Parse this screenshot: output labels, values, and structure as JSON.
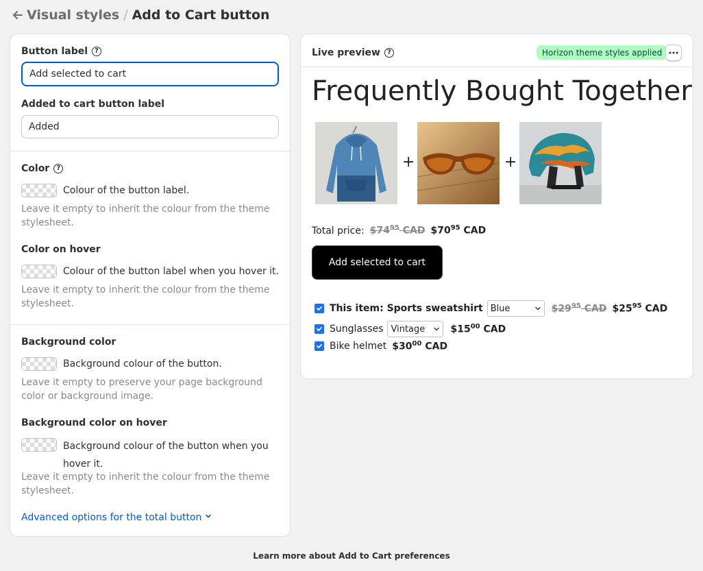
{
  "header": {
    "parent": "Visual styles",
    "separator": "/",
    "current": "Add to Cart button"
  },
  "settings": {
    "button_label": {
      "label": "Button label",
      "value": "Add selected to cart"
    },
    "added_label": {
      "label": "Added to cart button label",
      "value": "Added"
    },
    "color": {
      "label": "Color",
      "swatch_text": "Colour of the button label.",
      "hint": "Leave it empty to inherit the colour from the theme stylesheet."
    },
    "color_hover": {
      "label": "Color on hover",
      "swatch_text": "Colour of the button label when you hover it.",
      "hint": "Leave it empty to inherit the colour from the theme stylesheet."
    },
    "bg_color": {
      "label": "Background color",
      "swatch_text": "Background colour of the button.",
      "hint": "Leave it empty to preserve your page background color or background image."
    },
    "bg_color_hover": {
      "label": "Background color on hover",
      "swatch_text": "Background colour of the button when you hover it.",
      "hint": "Leave it empty to inherit the colour from the theme stylesheet."
    },
    "advanced_link": "Advanced options for the total button"
  },
  "preview": {
    "title": "Live preview",
    "badge": "Horizon theme styles applied",
    "heading": "Frequently Bought Together",
    "plus": "+",
    "total_label": "Total price:",
    "total_old_main": "$74",
    "total_old_cents": "95",
    "total_old_cur": "CAD",
    "total_new_main": "$70",
    "total_new_cents": "95",
    "total_new_cur": "CAD",
    "button_label": "Add selected to cart",
    "items": [
      {
        "name": "This item: Sports sweatshirt",
        "option": "Blue",
        "old_main": "$29",
        "old_cents": "95",
        "old_cur": "CAD",
        "price_main": "$25",
        "price_cents": "95",
        "price_cur": "CAD"
      },
      {
        "name": "Sunglasses",
        "option": "Vintage",
        "price_main": "$15",
        "price_cents": "00",
        "price_cur": "CAD"
      },
      {
        "name": "Bike helmet",
        "price_main": "$30",
        "price_cents": "00",
        "price_cur": "CAD"
      }
    ]
  },
  "footer": {
    "link": "Learn more about Add to Cart preferences"
  },
  "colors": {
    "accent": "#005bd3",
    "badge_bg": "#affebf",
    "badge_text": "#014b40",
    "checkbox": "#1a73e8"
  }
}
